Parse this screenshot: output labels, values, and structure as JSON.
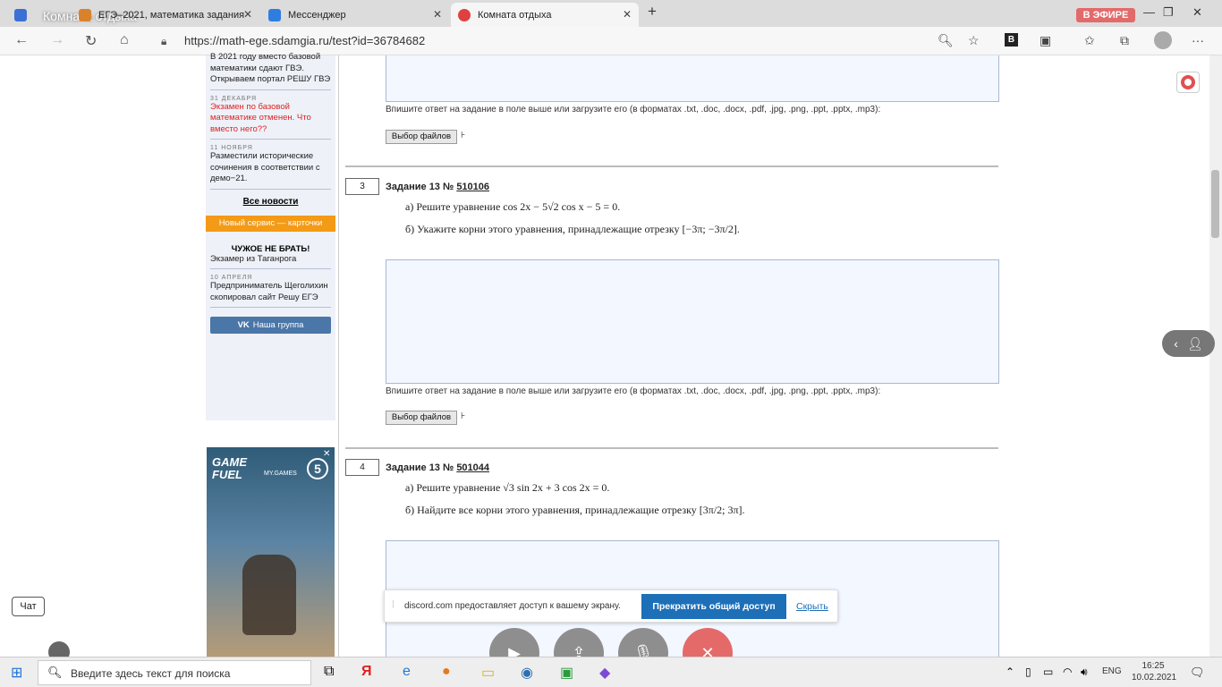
{
  "browser": {
    "room_title": "Комната отдыха",
    "tabs": [
      {
        "label": "ЕГЭ–2021, математика задания"
      },
      {
        "label": "Мессенджер"
      },
      {
        "label": "Комната отдыха"
      }
    ],
    "onair_badge": "В ЭФИРЕ",
    "url": "https://math-ege.sdamgia.ru/test?id=36784682"
  },
  "sidebar": {
    "items": [
      {
        "date": "",
        "text": "В 2021 году вместо базовой математики сдают ГВЭ. Открываем портал РЕШУ ГВЭ"
      },
      {
        "date": "31 ДЕКАБРЯ",
        "text": "Экзамен по базовой математике отменен. Что вместо него??"
      },
      {
        "date": "11 НОЯБРЯ",
        "text": "Разместили исторические сочинения в соответствии с демо−21."
      }
    ],
    "all_news": "Все новости",
    "cards_banner": "Новый сервис — карточки",
    "dont_take_title": "ЧУЖОЕ НЕ БРАТЬ!",
    "dont_take_text": "Экзамер из Таганрога",
    "item4_date": "10 АПРЕЛЯ",
    "item4_text": "Предприниматель Щеголихин скопировал сайт Решу ЕГЭ",
    "vk_button": "Наша группа",
    "ad_brand": "GAME FUEL",
    "ad_brand2": "MY.GAMES",
    "ad_num": "5"
  },
  "content": {
    "upload_note": "Впишите ответ на задание в поле выше или загрузите его (в форматах .txt, .doc, .docx, .pdf, .jpg, .png, .ppt, .pptx, .mp3):",
    "file_button": "Выбор файлов",
    "file_caret": "⊦",
    "tasks": [
      {
        "number": "3",
        "title_prefix": "Задание 13 №",
        "id": "510106",
        "line_a": "а) Решите уравнение  cos 2x − 5√2 cos x − 5 = 0.",
        "line_b": "б) Укажите корни этого уравнения, принадлежащие отрезку  [−3π; −3π/2]."
      },
      {
        "number": "4",
        "title_prefix": "Задание 13 №",
        "id": "501044",
        "line_a": "а) Решите уравнение  √3 sin 2x + 3 cos 2x = 0.",
        "line_b": "б) Найдите все корни этого уравнения, принадлежащие отрезку  [3π/2; 3π]."
      }
    ]
  },
  "overlay": {
    "chat_button": "Чат",
    "share_text": "discord.com предоставляет доступ к вашему экрану.",
    "share_stop": "Прекратить общий доступ",
    "share_hide": "Скрыть"
  },
  "taskbar": {
    "search_placeholder": "Введите здесь текст для поиска",
    "lang": "ENG",
    "time": "16:25",
    "date": "10.02.2021"
  }
}
